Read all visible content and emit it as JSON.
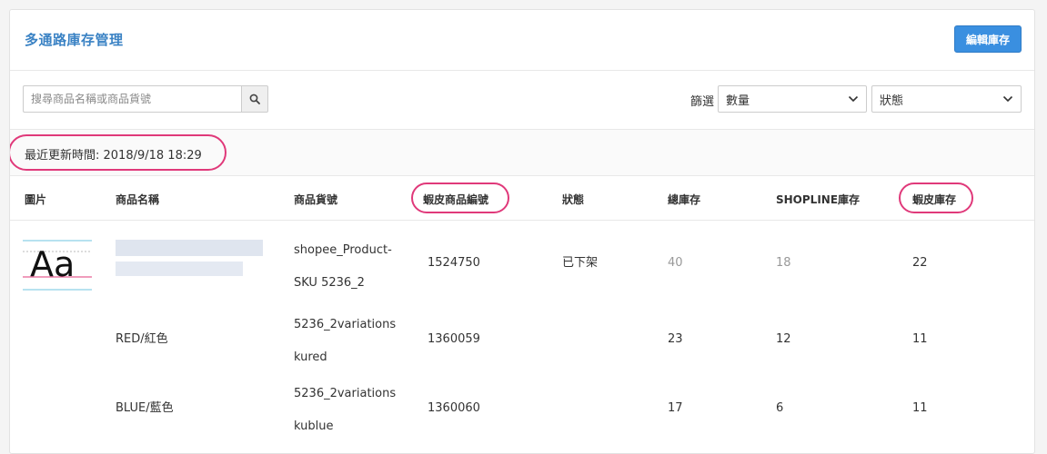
{
  "header": {
    "title": "多通路庫存管理",
    "edit_button": "編輯庫存"
  },
  "toolbar": {
    "search_placeholder": "搜尋商品名稱或商品貨號",
    "filter_label": "篩選",
    "quantity_select": "數量",
    "status_select": "狀態"
  },
  "update_info": "最近更新時間: 2018/9/18 18:29",
  "table": {
    "headers": [
      "圖片",
      "商品名稱",
      "商品貨號",
      "蝦皮商品編號",
      "狀態",
      "總庫存",
      "SHOPLINE庫存",
      "蝦皮庫存"
    ],
    "rows": [
      {
        "name": "",
        "sku_line1": "shopee_Product-",
        "sku_line2": "SKU 5236_2",
        "shopee_id": "1524750",
        "status": "已下架",
        "total": "40",
        "shopline": "18",
        "shopee": "22"
      },
      {
        "name": "RED/紅色",
        "sku_line1": "5236_2variations",
        "sku_line2": "kured",
        "shopee_id": "1360059",
        "status": "",
        "total": "23",
        "shopline": "12",
        "shopee": "11"
      },
      {
        "name": "BLUE/藍色",
        "sku_line1": "5236_2variations",
        "sku_line2": "kublue",
        "shopee_id": "1360060",
        "status": "",
        "total": "17",
        "shopline": "6",
        "shopee": "11"
      }
    ]
  },
  "thumbnail_text": "Aa",
  "colors": {
    "accent": "#3a8fe0",
    "title": "#3a82c4",
    "highlight_circle": "#e0397a"
  }
}
